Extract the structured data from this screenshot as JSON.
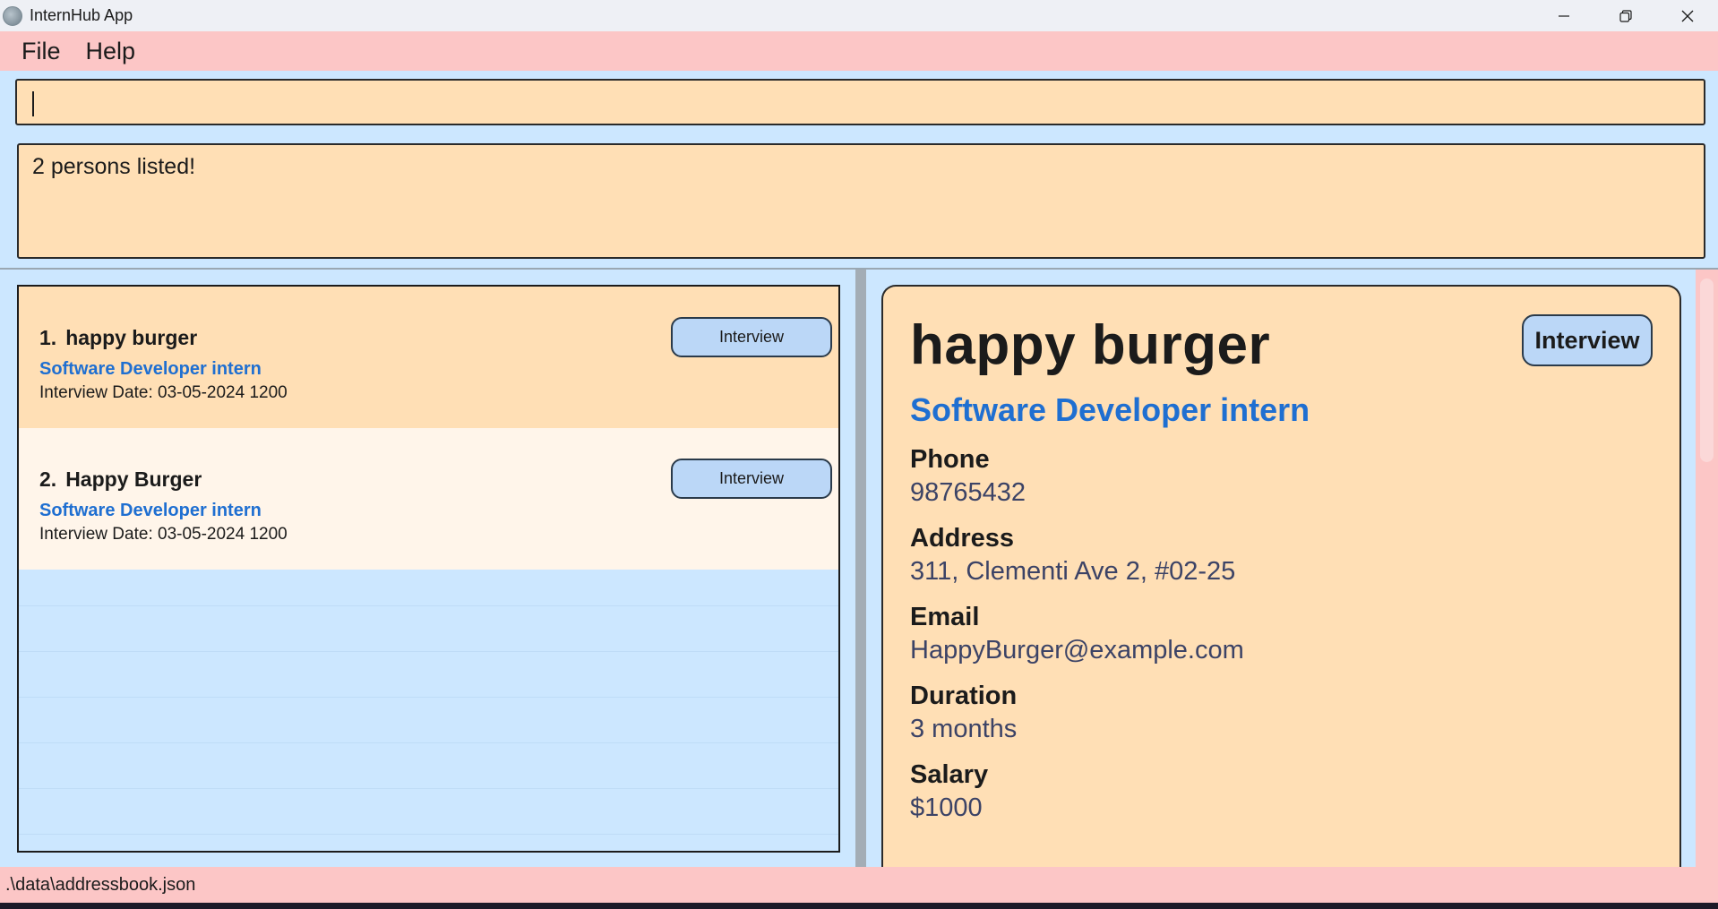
{
  "window": {
    "title": "InternHub App",
    "icon": "app-logo-icon"
  },
  "menu": {
    "file": "File",
    "help": "Help"
  },
  "command": {
    "value": ""
  },
  "result": {
    "message": "2 persons listed!"
  },
  "list": {
    "items": [
      {
        "index": "1.",
        "name": "happy burger",
        "role": "Software Developer intern",
        "interview_date": "Interview Date: 03-05-2024 1200",
        "tag": "Interview"
      },
      {
        "index": "2.",
        "name": "Happy Burger",
        "role": "Software Developer intern",
        "interview_date": "Interview Date: 03-05-2024 1200",
        "tag": "Interview"
      }
    ]
  },
  "detail": {
    "name": "happy burger",
    "tag": "Interview",
    "role": "Software Developer intern",
    "fields": [
      {
        "label": "Phone",
        "value": "98765432"
      },
      {
        "label": "Address",
        "value": "311, Clementi Ave 2, #02-25"
      },
      {
        "label": "Email",
        "value": "HappyBurger@example.com"
      },
      {
        "label": "Duration",
        "value": "3 months"
      },
      {
        "label": "Salary",
        "value": "$1000"
      }
    ]
  },
  "status": {
    "file_path": ".\\data\\addressbook.json"
  },
  "colors": {
    "menubar": "#fcc6c6",
    "panel_background": "#cce7ff",
    "card_selected": "#ffdfb5",
    "card_plain": "#fff5ea",
    "role_text": "#1f6fd1",
    "tag_background": "#bbd7f7"
  }
}
